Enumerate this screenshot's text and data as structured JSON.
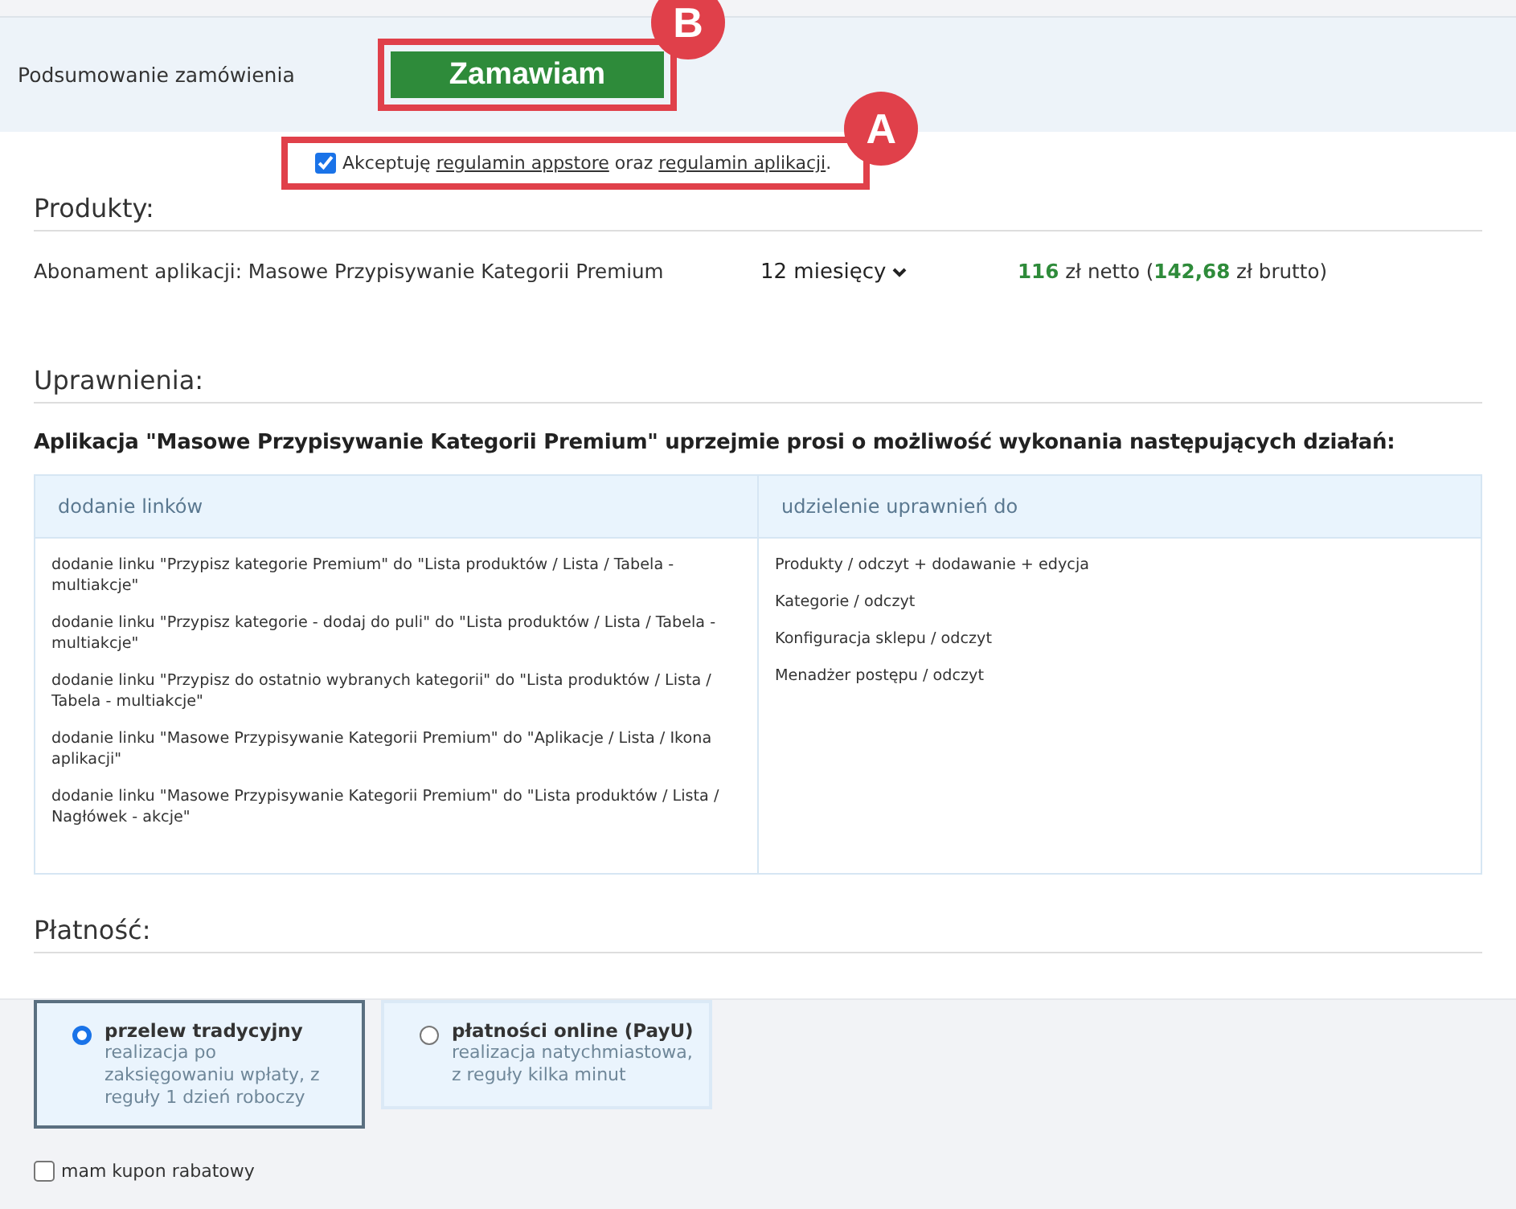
{
  "header": {
    "title": "Podsumowanie zamówienia",
    "order_button": "Zamawiam"
  },
  "terms": {
    "checked": true,
    "text_before": "Akceptuję",
    "link_1": "regulamin appstore",
    "text_between": "oraz",
    "link_2": "regulamin aplikacji",
    "text_after": "."
  },
  "callouts": [
    {
      "label": "B"
    },
    {
      "label": "A"
    }
  ],
  "products": {
    "heading": "Produkty:",
    "items": [
      {
        "name": "Abonament aplikacji: Masowe Przypisywanie Kategorii Premium",
        "period": "12 miesięcy",
        "price": "**116** zł netto (**142,68** zł brutto)"
      }
    ]
  },
  "permissions": {
    "heading": "Uprawnienia:",
    "intro": "Aplikacja \"Masowe Przypisywanie Kategorii Premium\" uprzejmie prosi o możliwość wykonania następujących działań:",
    "columns": [
      "dodanie linków",
      "udzielenie uprawnień do"
    ],
    "links": [
      "dodanie linku \"Przypisz kategorie Premium\" do \"Lista produktów / Lista / Tabela - multiakcje\"",
      "dodanie linku \"Przypisz kategorie - dodaj do puli\" do \"Lista produktów / Lista / Tabela - multiakcje\"",
      "dodanie linku \"Przypisz do ostatnio wybranych kategorii\" do \"Lista produktów / Lista / Tabela - multiakcje\"",
      "dodanie linku \"Masowe Przypisywanie Kategorii Premium\" do \"Aplikacje / Lista / Ikona aplikacji\"",
      "dodanie linku \"Masowe Przypisywanie Kategorii Premium\" do \"Lista produktów / Lista / Nagłówek - akcje\""
    ],
    "grants": [
      "Produkty / odczyt + dodawanie + edycja",
      "Kategorie / odczyt",
      "Konfiguracja sklepu / odczyt",
      "Menadżer postępu / odczyt"
    ]
  },
  "payment": {
    "heading": "Płatność:",
    "methods": [
      {
        "title": "przelew tradycyjny",
        "description": "realizacja po zaksięgowaniu wpłaty, z reguły 1 dzień roboczy",
        "selected": true
      },
      {
        "title": "płatności online (PayU)",
        "description": "realizacja natychmiastowa, z reguły kilka minut",
        "selected": false
      }
    ],
    "coupon": {
      "label": "mam kupon rabatowy",
      "checked": false
    }
  }
}
